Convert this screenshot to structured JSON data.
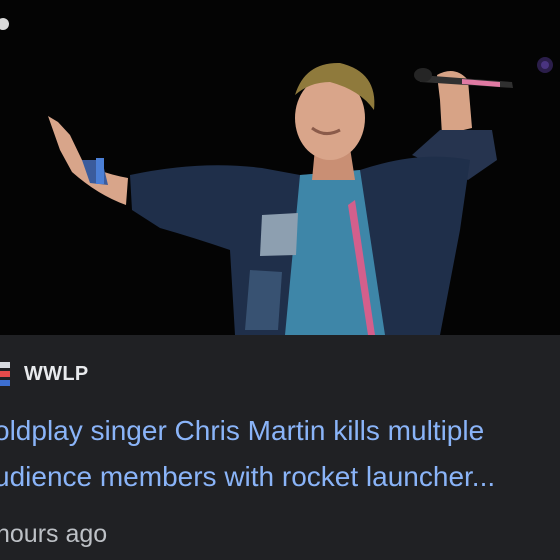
{
  "article": {
    "source": "WWLP",
    "headline_line1": "oldplay singer Chris Martin kills multiple",
    "headline_line2": "udience members with rocket launcher...",
    "time": "hours ago"
  },
  "colors": {
    "card_background": "#202124",
    "headline": "#8ab4f8",
    "source_text": "#e8eaed",
    "time_text": "#bdc1c6"
  },
  "icons": {
    "source_logo": "wwlp-logo-icon"
  }
}
